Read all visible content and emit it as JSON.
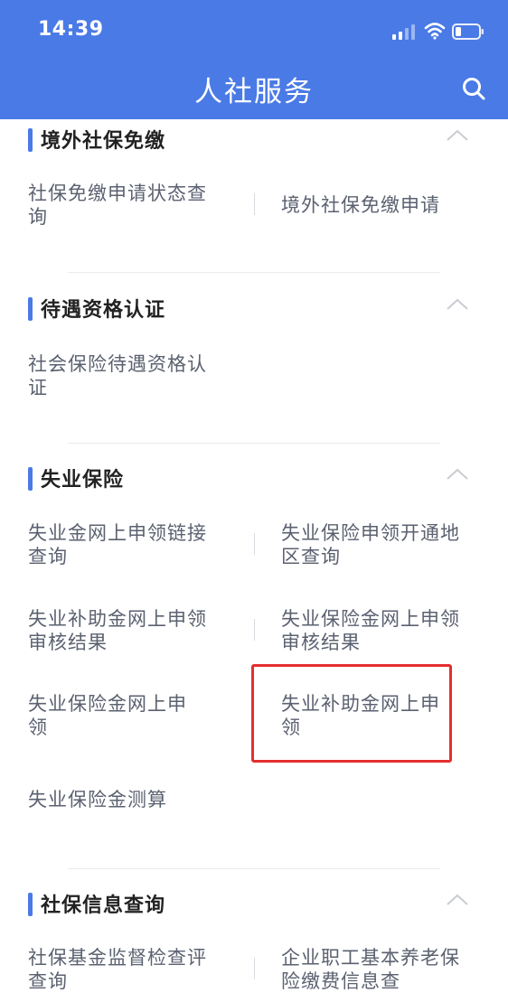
{
  "status_bar": {
    "time": "14:39"
  },
  "nav": {
    "title": "人社服务"
  },
  "sections": [
    {
      "title": "境外社保免缴",
      "items": [
        "社保免缴申请状态查询",
        "境外社保免缴申请"
      ]
    },
    {
      "title": "待遇资格认证",
      "items": [
        "社会保险待遇资格认证"
      ]
    },
    {
      "title": "失业保险",
      "items": [
        "失业金网上申领链接查询",
        "失业保险申领开通地区查询",
        "失业补助金网上申领审核结果",
        "失业保险金网上申领审核结果",
        "失业保险金网上申领",
        "失业补助金网上申领",
        "失业保险金测算"
      ]
    },
    {
      "title": "社保信息查询",
      "items": [
        "社保基金监督检查评查询",
        "企业职工基本养老保险缴费信息查"
      ]
    }
  ],
  "colors": {
    "header": "#4a7ae6",
    "accent": "#4a7ae6",
    "highlight": "#e52e2e"
  }
}
